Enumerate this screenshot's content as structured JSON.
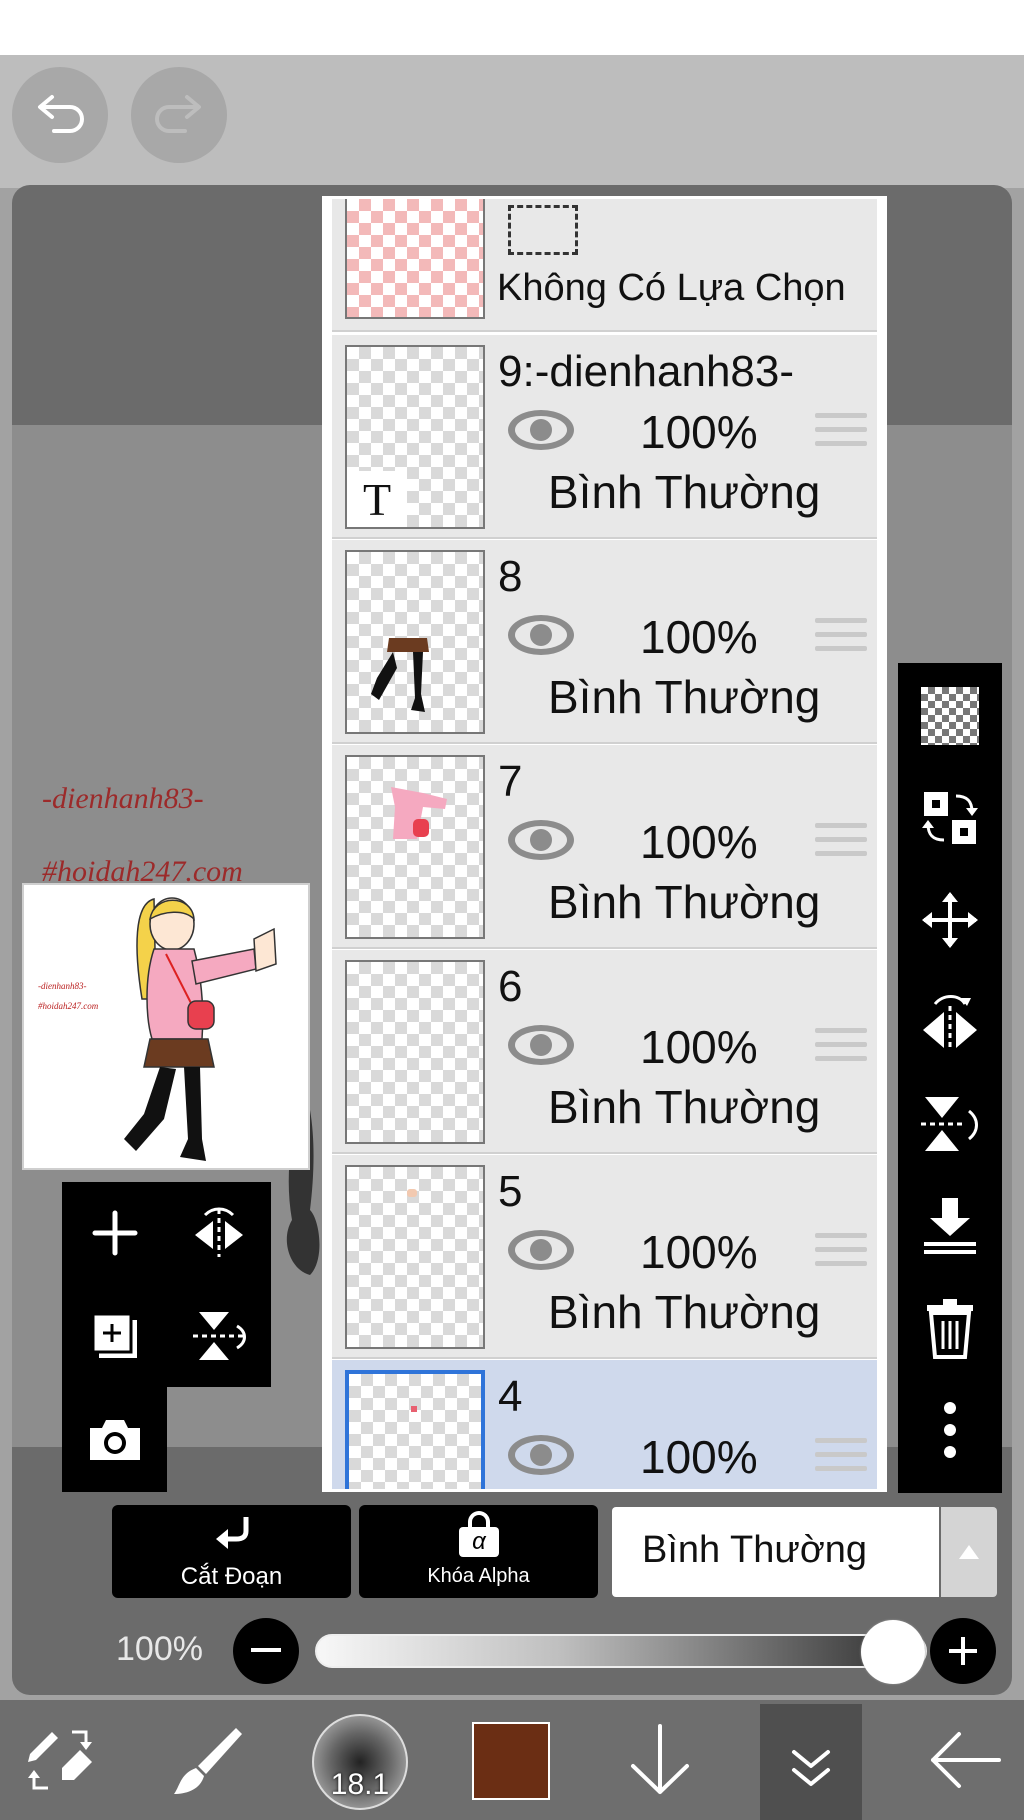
{
  "toolbar_top": {
    "undo_icon": "undo-icon",
    "redo_icon": "redo-icon"
  },
  "canvas": {
    "watermark_line1": "-dienhanh83-",
    "watermark_line2": "#hoidah247.com"
  },
  "preview": {
    "wm_line1": "-dienhanh83-",
    "wm_line2": "#hoidah247.com"
  },
  "selection_layer": {
    "label": "Không Có Lựa Chọn"
  },
  "layers": [
    {
      "name": "9:-dienhanh83-",
      "opacity": "100%",
      "blend": "Bình Thường",
      "visible": true,
      "type": "text",
      "thumb_glyph": "T"
    },
    {
      "name": "8",
      "opacity": "100%",
      "blend": "Bình Thường",
      "visible": true
    },
    {
      "name": "7",
      "opacity": "100%",
      "blend": "Bình Thường",
      "visible": true
    },
    {
      "name": "6",
      "opacity": "100%",
      "blend": "Bình Thường",
      "visible": true
    },
    {
      "name": "5",
      "opacity": "100%",
      "blend": "Bình Thường",
      "visible": true
    },
    {
      "name": "4",
      "opacity": "100%",
      "blend": "Bình Thường",
      "visible": true,
      "selected": true
    }
  ],
  "actions": {
    "clip_label": "Cắt Đoạn",
    "alpha_lock_label": "Khóa Alpha",
    "alpha_symbol": "α",
    "blend_mode": "Bình Thường"
  },
  "opacity": {
    "label": "100%",
    "value": 1.0,
    "minus": "−",
    "plus": "+"
  },
  "bottom": {
    "brush_size": "18.1",
    "color": "#6b2e14"
  },
  "colors": {
    "accent": "#2f74d9",
    "panel": "#6b6b6b",
    "watermark": "#9c2a2a"
  }
}
